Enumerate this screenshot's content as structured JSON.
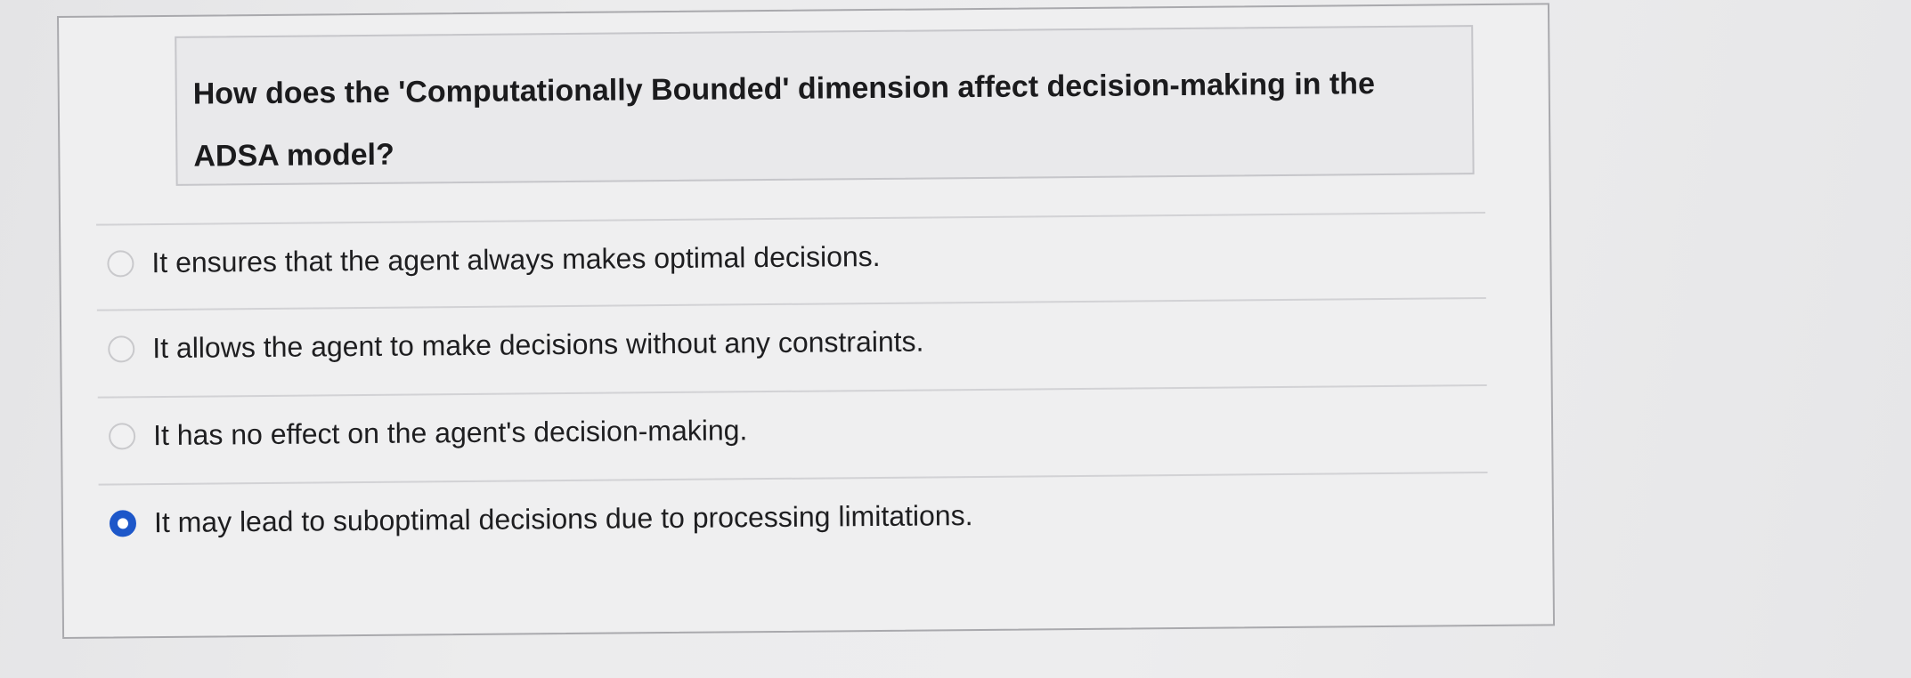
{
  "question": {
    "text": "How does the 'Computationally Bounded' dimension affect decision-making in the ADSA model?"
  },
  "options": [
    {
      "label": "It ensures that the agent always makes optimal decisions.",
      "selected": false
    },
    {
      "label": "It allows the agent to make decisions without any constraints.",
      "selected": false
    },
    {
      "label": "It has no effect on the agent's decision-making.",
      "selected": false
    },
    {
      "label": "It may lead to suboptimal decisions due to processing limitations.",
      "selected": true
    }
  ],
  "colors": {
    "selected_radio": "#1d57c9",
    "background": "#ececed"
  }
}
